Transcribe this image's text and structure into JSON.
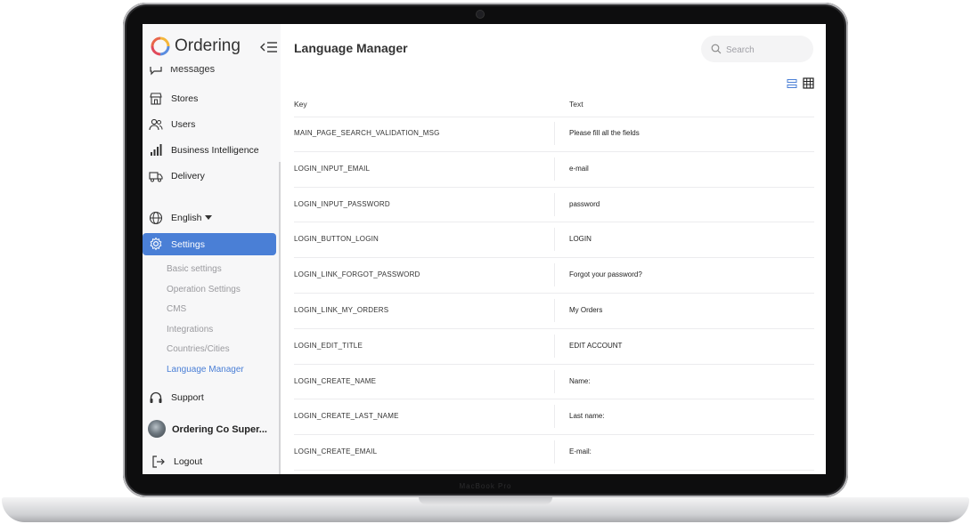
{
  "app": {
    "brand": "Ordering"
  },
  "device": {
    "base_brand": "MacBook Pro"
  },
  "sidebar": {
    "partial_item": "Messages",
    "items": [
      {
        "label": "Stores",
        "icon": "store-icon"
      },
      {
        "label": "Users",
        "icon": "users-icon"
      },
      {
        "label": "Business Intelligence",
        "icon": "chart-bars-icon"
      },
      {
        "label": "Delivery",
        "icon": "truck-icon"
      }
    ],
    "language": "English",
    "settings_label": "Settings",
    "settings_sub": [
      "Basic settings",
      "Operation Settings",
      "CMS",
      "Integrations",
      "Countries/Cities",
      "Language Manager"
    ],
    "active_sub": "Language Manager",
    "support": "Support",
    "profile_name": "Ordering Co Super...",
    "logout": "Logout"
  },
  "colors": {
    "accent": "#4a7fd6",
    "sidebar_bg": "#f7f7f8",
    "text": "#333333",
    "muted": "#9a9a9e"
  },
  "main": {
    "title": "Language Manager",
    "search_placeholder": "Search",
    "table": {
      "col_key": "Key",
      "col_text": "Text",
      "rows": [
        {
          "key": "MAIN_PAGE_SEARCH_VALIDATION_MSG",
          "text": "Please fill all the fields"
        },
        {
          "key": "LOGIN_INPUT_EMAIL",
          "text": "e-mail"
        },
        {
          "key": "LOGIN_INPUT_PASSWORD",
          "text": "password"
        },
        {
          "key": "LOGIN_BUTTON_LOGIN",
          "text": "LOGIN"
        },
        {
          "key": "LOGIN_LINK_FORGOT_PASSWORD",
          "text": "Forgot your password?"
        },
        {
          "key": "LOGIN_LINK_MY_ORDERS",
          "text": "My Orders"
        },
        {
          "key": "LOGIN_EDIT_TITLE",
          "text": "EDIT ACCOUNT"
        },
        {
          "key": "LOGIN_CREATE_NAME",
          "text": "Name:"
        },
        {
          "key": "LOGIN_CREATE_LAST_NAME",
          "text": "Last name:"
        },
        {
          "key": "LOGIN_CREATE_EMAIL",
          "text": "E-mail:"
        }
      ]
    }
  }
}
